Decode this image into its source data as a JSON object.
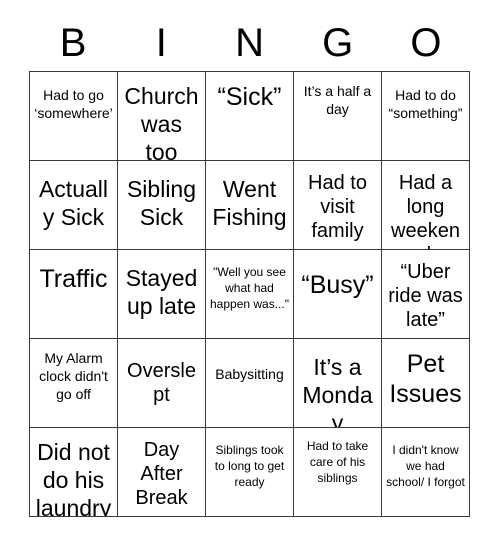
{
  "card": {
    "title": "BINGO",
    "header_letters": [
      "B",
      "I",
      "N",
      "G",
      "O"
    ],
    "rows": [
      [
        {
          "text": "Had to go ‘somewhere’",
          "size": "sm",
          "pad": "pad-2"
        },
        {
          "text": "Church was too long",
          "size": "lg",
          "pad": "pad-1"
        },
        {
          "text": "“Sick”",
          "size": "xl",
          "pad": "pad-1"
        },
        {
          "text": "It’s a half a day",
          "size": "sm",
          "pad": "pad-1"
        },
        {
          "text": "Had to do “something”",
          "size": "sm",
          "pad": "pad-2"
        }
      ],
      [
        {
          "text": "Actually Sick",
          "size": "lg",
          "pad": "pad-2"
        },
        {
          "text": "Sibling Sick",
          "size": "lg",
          "pad": "pad-2"
        },
        {
          "text": "Went Fishing",
          "size": "lg",
          "pad": "pad-2"
        },
        {
          "text": "Had to visit family",
          "size": "md",
          "pad": "pad-1"
        },
        {
          "text": "Had a long weekend",
          "size": "md",
          "pad": "pad-1"
        }
      ],
      [
        {
          "text": "Traffic",
          "size": "xl",
          "pad": "pad-2"
        },
        {
          "text": "Stayed up late",
          "size": "lg",
          "pad": "pad-2"
        },
        {
          "text": "\"Well you see what had happen was...\"",
          "size": "xs",
          "pad": "pad-2"
        },
        {
          "text": "“Busy”",
          "size": "xl",
          "pad": "pad-3"
        },
        {
          "text": "“Uber ride was late”",
          "size": "md",
          "pad": "pad-1"
        }
      ],
      [
        {
          "text": "My Alarm clock didn't go off",
          "size": "sm",
          "pad": "pad-1"
        },
        {
          "text": "Overslept",
          "size": "md",
          "pad": "pad-3"
        },
        {
          "text": "Babysitting",
          "size": "sm",
          "pad": "pad-4"
        },
        {
          "text": "It’s a Monday",
          "size": "lg",
          "pad": "pad-2"
        },
        {
          "text": "Pet Issues",
          "size": "xl",
          "pad": "pad-1"
        }
      ],
      [
        {
          "text": "Did not do his laundry",
          "size": "lg",
          "pad": "pad-1"
        },
        {
          "text": "Day After Break",
          "size": "md",
          "pad": "pad-1"
        },
        {
          "text": "Siblings took to long to get ready",
          "size": "xs",
          "pad": "pad-2"
        },
        {
          "text": "Had to take care of his siblings",
          "size": "xs",
          "pad": "pad-1"
        },
        {
          "text": "I didn't know we had school/ I forgot",
          "size": "xs",
          "pad": "pad-2"
        }
      ]
    ]
  },
  "colors": {
    "background": "#ffffff",
    "text": "#000000",
    "grid_line": "#3a3a3a"
  }
}
